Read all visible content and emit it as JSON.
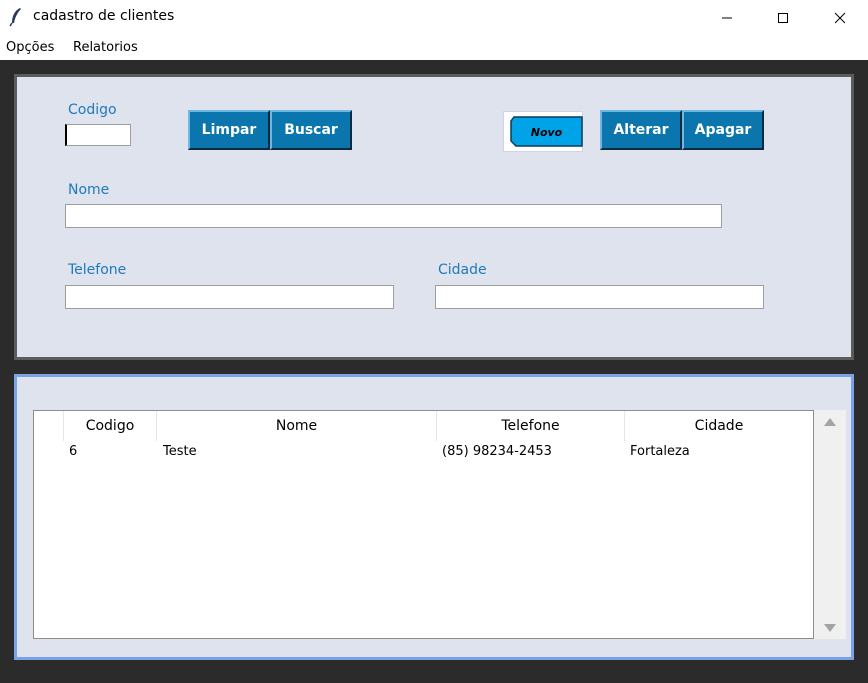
{
  "window": {
    "title": "cadastro de clientes",
    "icon": "feather-icon"
  },
  "menu": {
    "items": [
      "Opções",
      "Relatorios"
    ]
  },
  "form": {
    "codigo_label": "Codigo",
    "codigo_value": "",
    "nome_label": "Nome",
    "nome_value": "",
    "telefone_label": "Telefone",
    "telefone_value": "",
    "cidade_label": "Cidade",
    "cidade_value": "",
    "buttons": {
      "limpar": "Limpar",
      "buscar": "Buscar",
      "novo": "Novo",
      "alterar": "Alterar",
      "apagar": "Apagar"
    }
  },
  "table": {
    "columns": [
      "Codigo",
      "Nome",
      "Telefone",
      "Cidade"
    ],
    "rows": [
      [
        "6",
        "Teste",
        "(85) 98234-2453",
        "Fortaleza"
      ]
    ]
  },
  "colors": {
    "frame_bg": "#dfe3ee",
    "label": "#1f7ab8",
    "button": "#0b76ad",
    "novo_button": "#00a2e8",
    "window_bg": "#2b2b2b"
  }
}
